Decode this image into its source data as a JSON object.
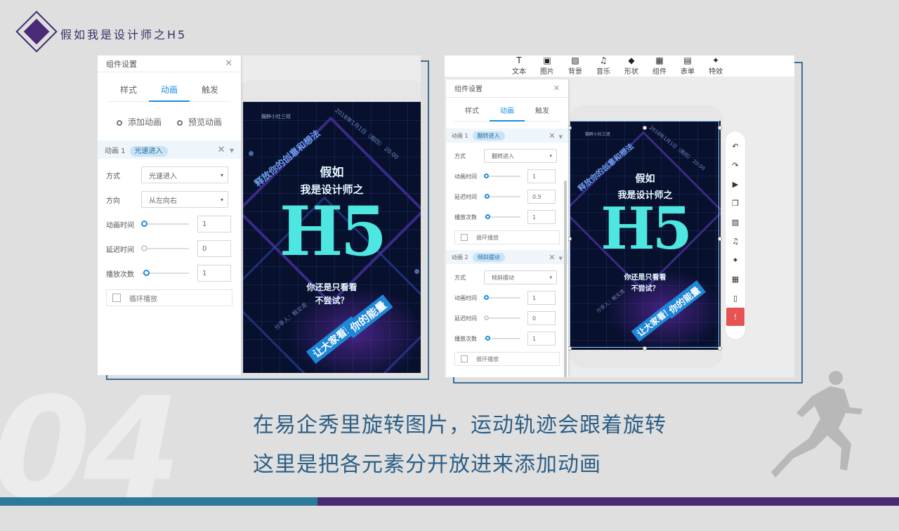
{
  "header": {
    "title": "假如我是设计师之H5"
  },
  "big_number": "04",
  "captions": [
    "在易企秀里旋转图片，运动轨迹会跟着旋转",
    "这里是把各元素分开放进来添加动画"
  ],
  "colors": {
    "accent_blue": "#1a8ee0",
    "caption": "#2d5f86",
    "brand_purple": "#4a2a72",
    "brand_teal": "#2b7a9c",
    "alert": "#e55353"
  },
  "left": {
    "panel": {
      "title": "组件设置",
      "tabs": [
        "样式",
        "动画",
        "触发"
      ],
      "actions": [
        "添加动画",
        "预览动画"
      ],
      "anim": {
        "label": "动画 1",
        "name": "光速进入",
        "fields": {
          "mode_label": "方式",
          "mode": "光速进入",
          "dir_label": "方向",
          "dir": "从左向右",
          "dur_label": "动画时间",
          "dur": "1",
          "delay_label": "延迟时间",
          "delay": "0",
          "count_label": "播放次数",
          "count": "1",
          "loop": "循环播放"
        }
      }
    }
  },
  "right": {
    "toolbar": [
      {
        "label": "文本",
        "icon": "T"
      },
      {
        "label": "图片",
        "icon": "▣"
      },
      {
        "label": "背景",
        "icon": "▨"
      },
      {
        "label": "音乐",
        "icon": "♫"
      },
      {
        "label": "形状",
        "icon": "◆"
      },
      {
        "label": "组件",
        "icon": "▦"
      },
      {
        "label": "表单",
        "icon": "▤"
      },
      {
        "label": "特效",
        "icon": "✦"
      }
    ],
    "panel": {
      "title": "组件设置",
      "tabs": [
        "样式",
        "动画",
        "触发"
      ],
      "anim1": {
        "label": "动画 1",
        "name": "翻转进入",
        "mode_label": "方式",
        "mode": "翻转进入",
        "dur_label": "动画时间",
        "dur": "1",
        "delay_label": "延迟时间",
        "delay": "0.5",
        "count_label": "播放次数",
        "count": "1",
        "loop": "循环播放"
      },
      "anim2": {
        "label": "动画 2",
        "name": "倾斜摆动",
        "mode_label": "方式",
        "mode": "倾斜摆动",
        "dur_label": "动画时间",
        "dur": "1",
        "delay_label": "延迟时间",
        "delay": "0",
        "count_label": "播放次数",
        "count": "1",
        "loop": "循环播放"
      }
    },
    "side_tools": [
      "↶",
      "↷",
      "▶",
      "❐",
      "▨",
      "♫",
      "✦",
      "▦",
      "▯",
      "!"
    ]
  },
  "poster": {
    "brand": "猫醉小灶三班",
    "date": "2018年1月1日（周四） 20:00",
    "slogan": "释放你的创意和想法",
    "line1": "假如",
    "line2": "我是设计师之",
    "h5": "H5",
    "line3": "你还是只看看",
    "line4": "不尝试？",
    "sharer": "分享人：鲸文鸢",
    "banner1": "让大家看到",
    "banner2": "你的能量"
  }
}
